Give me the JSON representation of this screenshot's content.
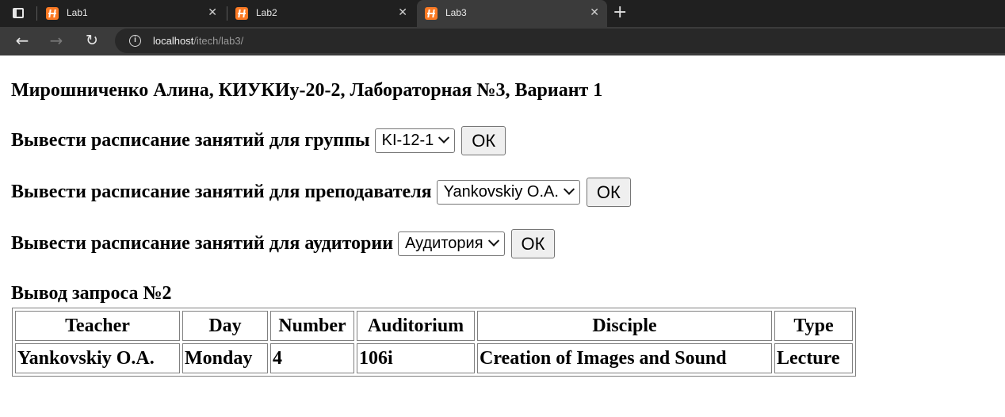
{
  "browser": {
    "tabs": [
      {
        "title": "Lab1",
        "close": "✕"
      },
      {
        "title": "Lab2",
        "close": "✕"
      },
      {
        "title": "Lab3",
        "close": "✕"
      }
    ],
    "new_tab": "+",
    "nav": {
      "back": "←",
      "forward": "→",
      "reload": "↻"
    },
    "url": {
      "host": "localhost",
      "path": "/itech/lab3/"
    },
    "info_icon": "i"
  },
  "page": {
    "heading": "Мирошниченко Алина, КИУКИу-20-2, Лабораторная №3, Вариант 1",
    "forms": [
      {
        "label": "Вывести расписание занятий для группы",
        "selected": "KI-12-1",
        "button": "ОК"
      },
      {
        "label": "Вывести расписание занятий для преподавателя",
        "selected": "Yankovskiy O.A.",
        "button": "ОК"
      },
      {
        "label": "Вывести расписание занятий для аудитории",
        "selected": "Аудитория",
        "button": "ОК"
      }
    ],
    "result_title": "Вывод запроса №2",
    "table": {
      "headers": [
        "Teacher",
        "Day",
        "Number",
        "Auditorium",
        "Disciple",
        "Type"
      ],
      "rows": [
        [
          "Yankovskiy O.A.",
          "Monday",
          "4",
          "106i",
          "Creation of Images and Sound",
          "Lecture"
        ]
      ]
    }
  },
  "colors": {
    "favicon": "#fb7a24",
    "tabstrip": "#202020",
    "toolbar": "#3b3b3b"
  }
}
